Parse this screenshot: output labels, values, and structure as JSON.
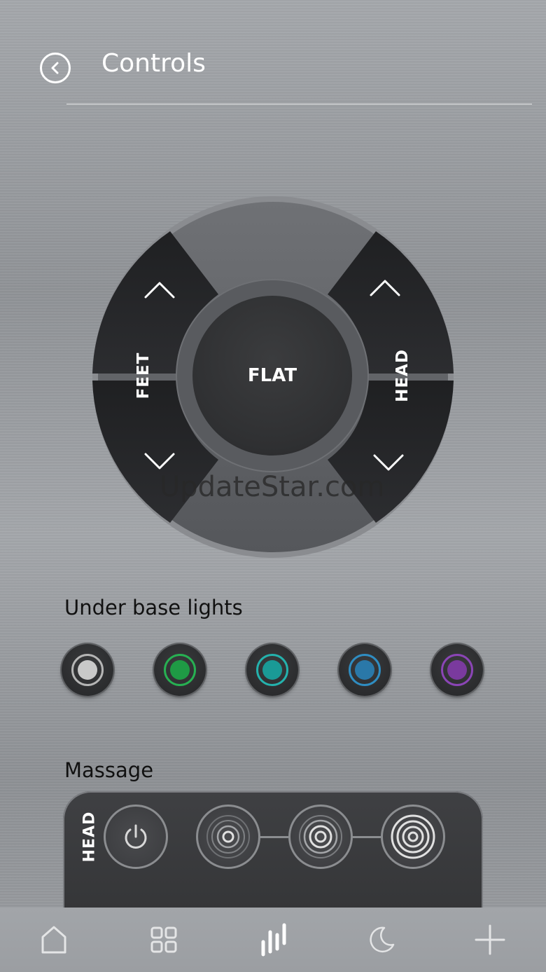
{
  "header": {
    "title": "Controls",
    "back_icon": "chevron-left-circle-icon"
  },
  "dial": {
    "flat_label": "FLAT",
    "feet_label": "FEET",
    "head_label": "HEAD",
    "up_icon": "chevron-up-icon",
    "down_icon": "chevron-down-icon"
  },
  "watermark": "UpdateStar.com",
  "lights": {
    "title": "Under base lights",
    "options": [
      {
        "name": "white",
        "color": "#c9c9c9",
        "ring": "#b5b5b5"
      },
      {
        "name": "green",
        "color": "#1f9a45",
        "ring": "#27b052"
      },
      {
        "name": "teal",
        "color": "#1a9a96",
        "ring": "#24b2ad"
      },
      {
        "name": "blue",
        "color": "#2a78a8",
        "ring": "#2f8dc2"
      },
      {
        "name": "purple",
        "color": "#7a3a9e",
        "ring": "#8b45b6"
      }
    ]
  },
  "massage": {
    "title": "Massage",
    "zone_label": "HEAD",
    "power_icon": "power-icon",
    "levels": [
      {
        "name": "level-1",
        "icon": "intensity-low-icon"
      },
      {
        "name": "level-2",
        "icon": "intensity-medium-icon"
      },
      {
        "name": "level-3",
        "icon": "intensity-high-icon"
      }
    ]
  },
  "nav": {
    "items": [
      {
        "name": "home",
        "icon": "home-icon"
      },
      {
        "name": "grid",
        "icon": "grid-icon"
      },
      {
        "name": "controls",
        "icon": "bars-icon",
        "active": true
      },
      {
        "name": "sleep",
        "icon": "moon-icon"
      },
      {
        "name": "add",
        "icon": "plus-icon"
      }
    ]
  }
}
